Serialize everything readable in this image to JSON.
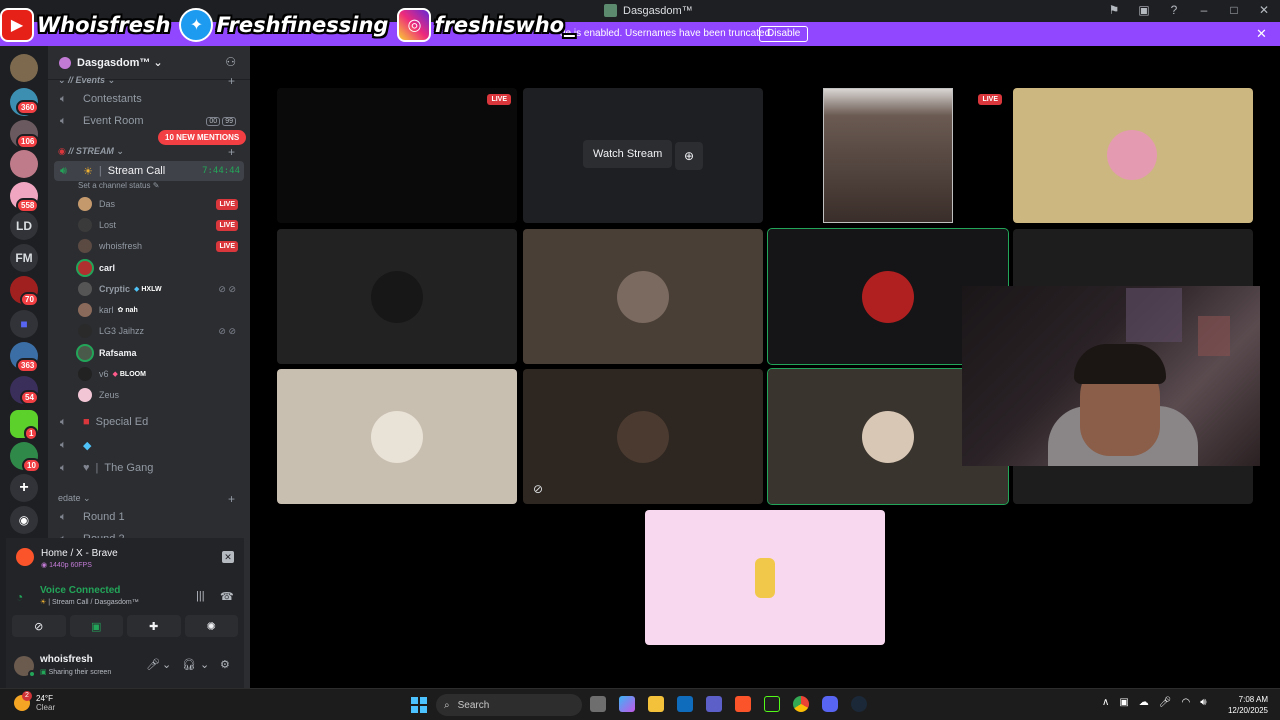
{
  "window": {
    "title": "Dasgasdom™"
  },
  "overlay": {
    "youtube": "Whoisfresh",
    "twitter": "Freshfinessing",
    "instagram": "freshiswho_"
  },
  "banner": {
    "text": "de is enabled. Usernames have been truncated.",
    "disable_label": "Disable"
  },
  "rail": {
    "badges": [
      "360",
      "106",
      "558",
      "70",
      "363",
      "54",
      "1",
      "10"
    ],
    "text_servers": [
      "LD",
      "FM"
    ]
  },
  "server": {
    "name": "Dasgasdom™",
    "mentions_pill": "10 NEW MENTIONS",
    "categories": {
      "events": "// Events",
      "stream": "// STREAM",
      "edate": "edate"
    },
    "event_channels": [
      {
        "name": "Contestants"
      },
      {
        "name": "Event Room",
        "tags": [
          "00",
          "99"
        ]
      }
    ],
    "stream_call": {
      "name": "Stream Call",
      "timer": "7:44:44",
      "status": "Set a channel status"
    },
    "members": [
      {
        "name": "Das",
        "live": "LIVE"
      },
      {
        "name": "Lost",
        "live": "LIVE"
      },
      {
        "name": "whoisfresh",
        "live": "LIVE"
      },
      {
        "name": "carl"
      },
      {
        "name": "Cryptic",
        "tag": "HXLW"
      },
      {
        "name": "karl",
        "tag": "nah"
      },
      {
        "name": "LG3 Jaihzz"
      },
      {
        "name": "Rafsama"
      },
      {
        "name": "v6",
        "tag": "BLOOM"
      },
      {
        "name": "Zeus"
      }
    ],
    "other_channels": [
      {
        "name": "Special Ed"
      },
      {
        "name": ""
      },
      {
        "name": "The Gang"
      }
    ],
    "edate_channels": [
      {
        "name": "Round 1"
      },
      {
        "name": "Round 2"
      }
    ]
  },
  "stream_panel": {
    "title": "Home / X - Brave",
    "quality": "1440p 60FPS"
  },
  "voice_panel": {
    "status": "Voice Connected",
    "channel": "Stream Call / Dasgasdom™"
  },
  "user_panel": {
    "name": "whoisfresh",
    "status": "Sharing their screen"
  },
  "stage": {
    "live_label": "LIVE",
    "watch_label": "Watch Stream"
  },
  "taskbar": {
    "weather_temp": "24°F",
    "weather_desc": "Clear",
    "weather_badge": "2",
    "search_placeholder": "Search",
    "time": "7:08 AM",
    "date": "12/20/2025"
  }
}
